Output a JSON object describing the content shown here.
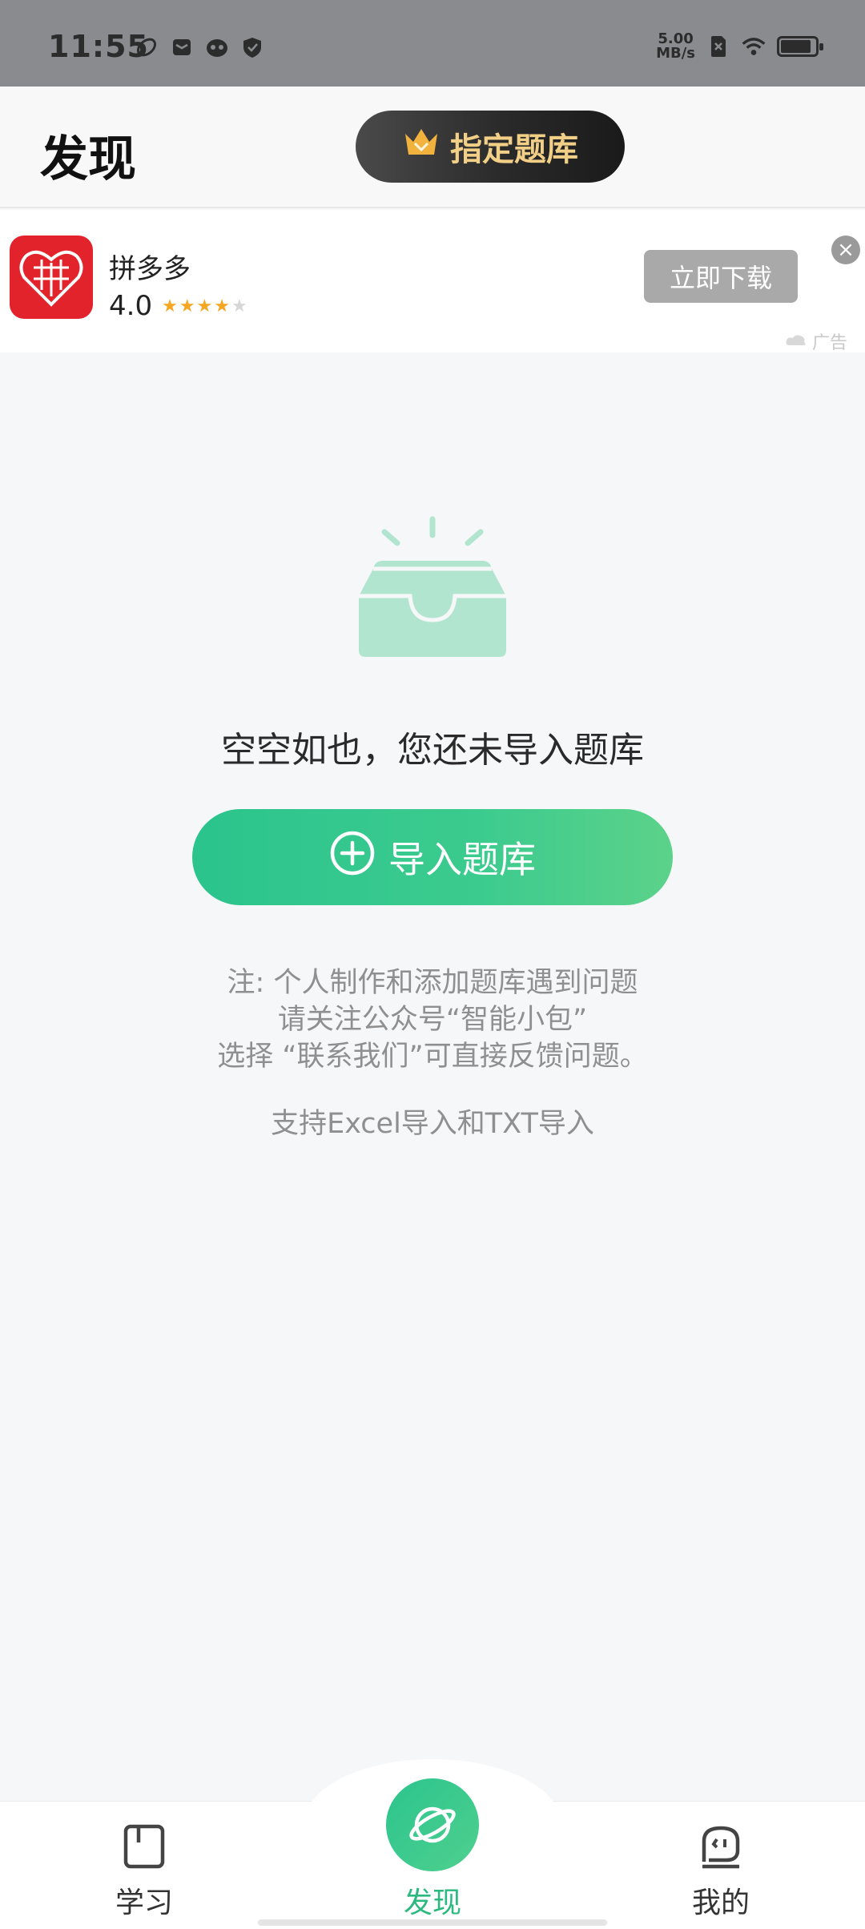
{
  "status_bar": {
    "time": "11:55",
    "net_speed_value": "5.00",
    "net_speed_unit": "MB/s",
    "battery_level": 0.8
  },
  "header": {
    "title": "发现",
    "premium_button_label": "指定题库"
  },
  "ad": {
    "app_name": "拼多多",
    "rating": "4.0",
    "stars_filled": 4,
    "stars_total": 5,
    "download_label": "立即下载",
    "close_label": "×",
    "tag": "广告"
  },
  "empty_state": {
    "message": "空空如也，您还未导入题库",
    "import_button_label": "导入题库",
    "note_line1": "注: 个人制作和添加题库遇到问题",
    "note_line2": "请关注公众号“智能小包”",
    "note_line3": "选择 “联系我们”可直接反馈问题。",
    "support_text": "支持Excel导入和TXT导入"
  },
  "bottom_nav": {
    "items": [
      {
        "label": "学习",
        "icon": "book-icon",
        "active": false
      },
      {
        "label": "发现",
        "icon": "planet-icon",
        "active": true
      },
      {
        "label": "我的",
        "icon": "face-icon",
        "active": false
      }
    ]
  },
  "colors": {
    "accent_green": "#2bc48d",
    "premium_gold": "#f2cf87",
    "ad_red": "#e3232b"
  }
}
